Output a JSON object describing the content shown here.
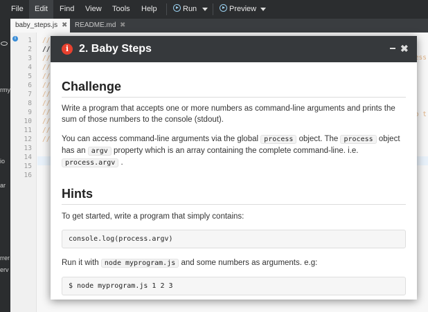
{
  "menu": {
    "items": [
      "File",
      "Edit",
      "Find",
      "View",
      "Tools",
      "Help"
    ],
    "run_label": "Run",
    "preview_label": "Preview"
  },
  "left_panel": {
    "fragments": [
      "rmy",
      "io",
      "ar",
      "rrer",
      "erv"
    ]
  },
  "tabs": [
    {
      "label": "baby_steps.js",
      "close": "✖",
      "active": true
    },
    {
      "label": "README.md",
      "close": "✖",
      "active": false
    }
  ],
  "editor": {
    "line_numbers": [
      "1",
      "2",
      "3",
      "4",
      "5",
      "6",
      "7",
      "8",
      "9",
      "10",
      "11",
      "12",
      "13",
      "14",
      "15",
      "16"
    ],
    "lines": [
      "//",
      "//",
      "//",
      "//",
      "//",
      "//",
      "//",
      "//",
      "//",
      "//",
      "//",
      "//",
      "",
      "",
      "",
      ""
    ],
    "edge_fragments": [
      "ess",
      "o t"
    ]
  },
  "modal": {
    "icon": "i",
    "title": "2. Baby Steps",
    "min_icon": "minimize-icon",
    "close_icon": "✖",
    "challenge": {
      "heading": "Challenge",
      "para1": "Write a program that accepts one or more numbers as command-line arguments and prints the sum of those numbers to the console (stdout).",
      "para2_parts": [
        "You can access command-line arguments via the global ",
        "process",
        " object. The ",
        "process",
        " object has an ",
        "argv",
        " property which is an array containing the complete command-line. i.e. ",
        "process.argv",
        " ."
      ]
    },
    "hints": {
      "heading": "Hints",
      "para1": "To get started, write a program that simply contains:",
      "code1": "console.log(process.argv)",
      "para2_parts": [
        "Run it with ",
        "node myprogram.js",
        " and some numbers as arguments. e.g:"
      ],
      "code2": "$ node myprogram.js 1 2 3"
    }
  }
}
